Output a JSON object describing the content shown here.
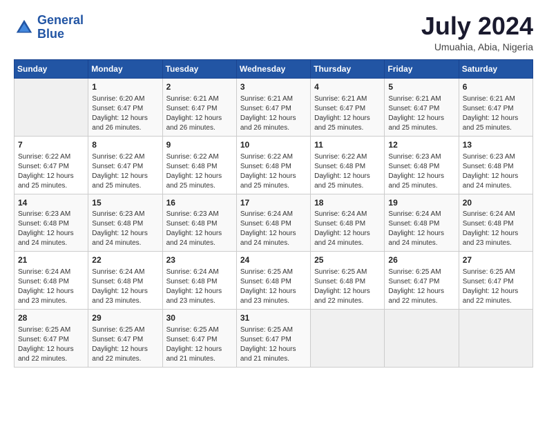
{
  "header": {
    "logo_line1": "General",
    "logo_line2": "Blue",
    "month": "July 2024",
    "location": "Umuahia, Abia, Nigeria"
  },
  "days_of_week": [
    "Sunday",
    "Monday",
    "Tuesday",
    "Wednesday",
    "Thursday",
    "Friday",
    "Saturday"
  ],
  "weeks": [
    [
      {
        "day": "",
        "info": ""
      },
      {
        "day": "1",
        "info": "Sunrise: 6:20 AM\nSunset: 6:47 PM\nDaylight: 12 hours\nand 26 minutes."
      },
      {
        "day": "2",
        "info": "Sunrise: 6:21 AM\nSunset: 6:47 PM\nDaylight: 12 hours\nand 26 minutes."
      },
      {
        "day": "3",
        "info": "Sunrise: 6:21 AM\nSunset: 6:47 PM\nDaylight: 12 hours\nand 26 minutes."
      },
      {
        "day": "4",
        "info": "Sunrise: 6:21 AM\nSunset: 6:47 PM\nDaylight: 12 hours\nand 25 minutes."
      },
      {
        "day": "5",
        "info": "Sunrise: 6:21 AM\nSunset: 6:47 PM\nDaylight: 12 hours\nand 25 minutes."
      },
      {
        "day": "6",
        "info": "Sunrise: 6:21 AM\nSunset: 6:47 PM\nDaylight: 12 hours\nand 25 minutes."
      }
    ],
    [
      {
        "day": "7",
        "info": "Sunrise: 6:22 AM\nSunset: 6:47 PM\nDaylight: 12 hours\nand 25 minutes."
      },
      {
        "day": "8",
        "info": "Sunrise: 6:22 AM\nSunset: 6:47 PM\nDaylight: 12 hours\nand 25 minutes."
      },
      {
        "day": "9",
        "info": "Sunrise: 6:22 AM\nSunset: 6:48 PM\nDaylight: 12 hours\nand 25 minutes."
      },
      {
        "day": "10",
        "info": "Sunrise: 6:22 AM\nSunset: 6:48 PM\nDaylight: 12 hours\nand 25 minutes."
      },
      {
        "day": "11",
        "info": "Sunrise: 6:22 AM\nSunset: 6:48 PM\nDaylight: 12 hours\nand 25 minutes."
      },
      {
        "day": "12",
        "info": "Sunrise: 6:23 AM\nSunset: 6:48 PM\nDaylight: 12 hours\nand 25 minutes."
      },
      {
        "day": "13",
        "info": "Sunrise: 6:23 AM\nSunset: 6:48 PM\nDaylight: 12 hours\nand 24 minutes."
      }
    ],
    [
      {
        "day": "14",
        "info": "Sunrise: 6:23 AM\nSunset: 6:48 PM\nDaylight: 12 hours\nand 24 minutes."
      },
      {
        "day": "15",
        "info": "Sunrise: 6:23 AM\nSunset: 6:48 PM\nDaylight: 12 hours\nand 24 minutes."
      },
      {
        "day": "16",
        "info": "Sunrise: 6:23 AM\nSunset: 6:48 PM\nDaylight: 12 hours\nand 24 minutes."
      },
      {
        "day": "17",
        "info": "Sunrise: 6:24 AM\nSunset: 6:48 PM\nDaylight: 12 hours\nand 24 minutes."
      },
      {
        "day": "18",
        "info": "Sunrise: 6:24 AM\nSunset: 6:48 PM\nDaylight: 12 hours\nand 24 minutes."
      },
      {
        "day": "19",
        "info": "Sunrise: 6:24 AM\nSunset: 6:48 PM\nDaylight: 12 hours\nand 24 minutes."
      },
      {
        "day": "20",
        "info": "Sunrise: 6:24 AM\nSunset: 6:48 PM\nDaylight: 12 hours\nand 23 minutes."
      }
    ],
    [
      {
        "day": "21",
        "info": "Sunrise: 6:24 AM\nSunset: 6:48 PM\nDaylight: 12 hours\nand 23 minutes."
      },
      {
        "day": "22",
        "info": "Sunrise: 6:24 AM\nSunset: 6:48 PM\nDaylight: 12 hours\nand 23 minutes."
      },
      {
        "day": "23",
        "info": "Sunrise: 6:24 AM\nSunset: 6:48 PM\nDaylight: 12 hours\nand 23 minutes."
      },
      {
        "day": "24",
        "info": "Sunrise: 6:25 AM\nSunset: 6:48 PM\nDaylight: 12 hours\nand 23 minutes."
      },
      {
        "day": "25",
        "info": "Sunrise: 6:25 AM\nSunset: 6:48 PM\nDaylight: 12 hours\nand 22 minutes."
      },
      {
        "day": "26",
        "info": "Sunrise: 6:25 AM\nSunset: 6:47 PM\nDaylight: 12 hours\nand 22 minutes."
      },
      {
        "day": "27",
        "info": "Sunrise: 6:25 AM\nSunset: 6:47 PM\nDaylight: 12 hours\nand 22 minutes."
      }
    ],
    [
      {
        "day": "28",
        "info": "Sunrise: 6:25 AM\nSunset: 6:47 PM\nDaylight: 12 hours\nand 22 minutes."
      },
      {
        "day": "29",
        "info": "Sunrise: 6:25 AM\nSunset: 6:47 PM\nDaylight: 12 hours\nand 22 minutes."
      },
      {
        "day": "30",
        "info": "Sunrise: 6:25 AM\nSunset: 6:47 PM\nDaylight: 12 hours\nand 21 minutes."
      },
      {
        "day": "31",
        "info": "Sunrise: 6:25 AM\nSunset: 6:47 PM\nDaylight: 12 hours\nand 21 minutes."
      },
      {
        "day": "",
        "info": ""
      },
      {
        "day": "",
        "info": ""
      },
      {
        "day": "",
        "info": ""
      }
    ]
  ]
}
